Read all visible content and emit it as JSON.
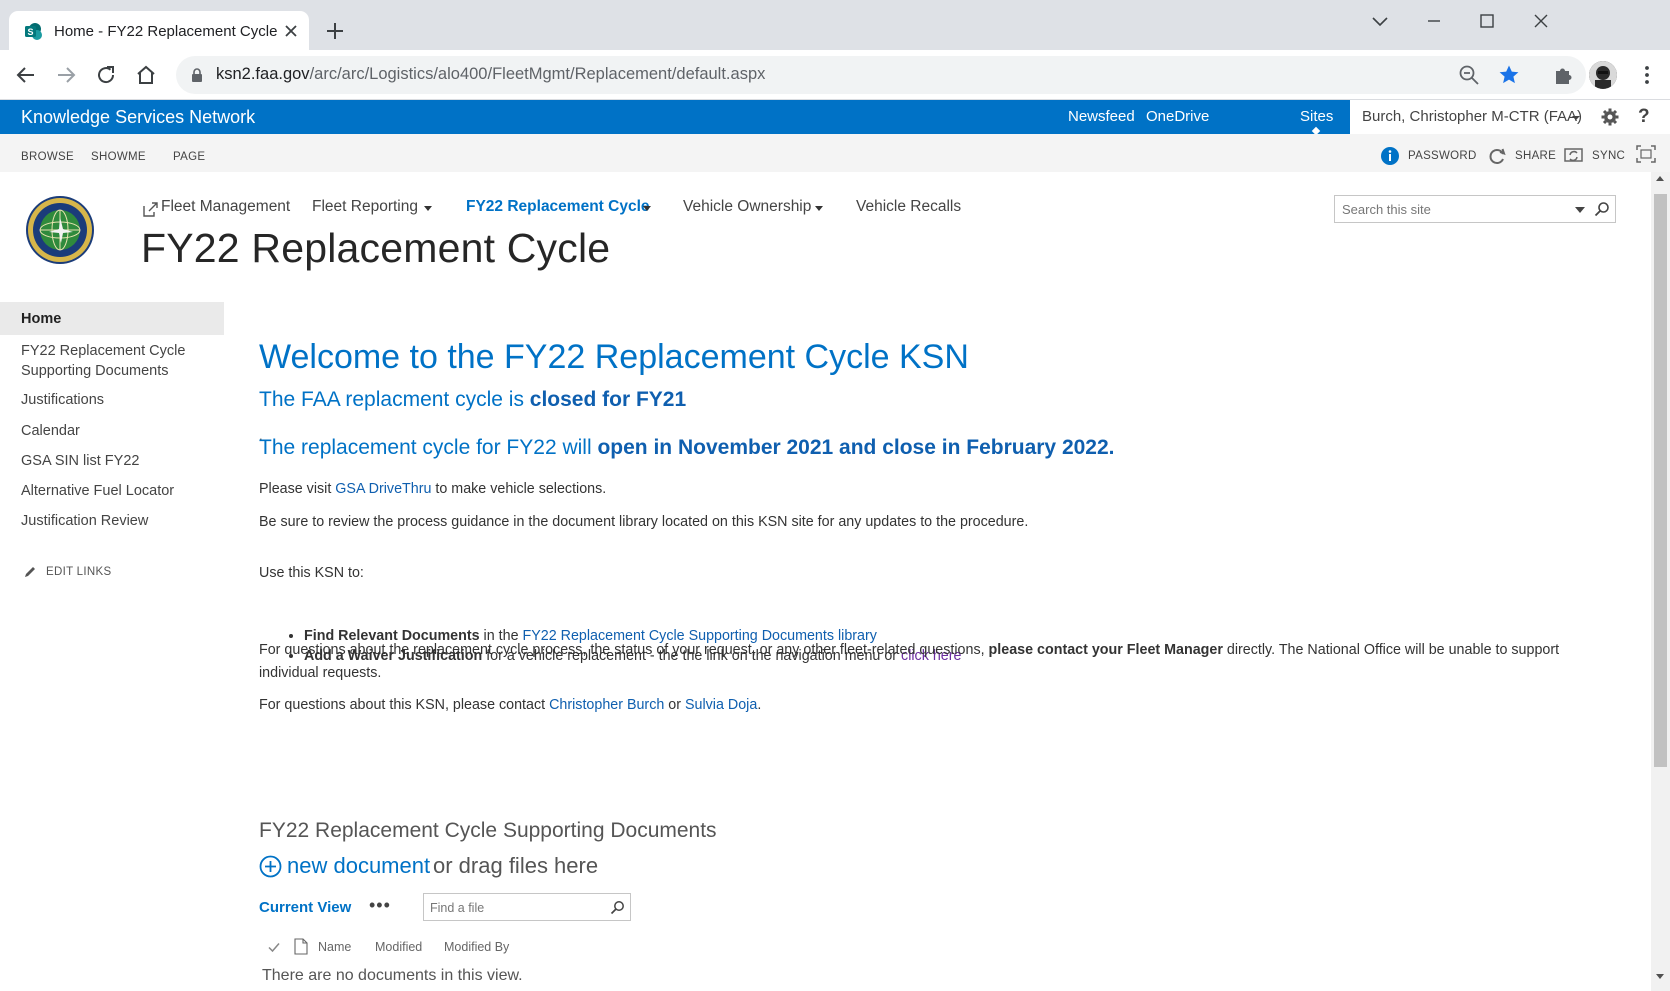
{
  "browser": {
    "tab_title": "Home - FY22 Replacement Cycle",
    "url_domain": "ksn2.faa.gov",
    "url_path": "/arc/arc/Logistics/alo400/FleetMgmt/Replacement/default.aspx"
  },
  "suite_bar": {
    "brand": "Knowledge Services Network",
    "links": [
      "Newsfeed",
      "OneDrive",
      "Sites"
    ],
    "user": "Burch, Christopher M-CTR (FAA)",
    "help": "?"
  },
  "ribbon": {
    "tabs": [
      "BROWSE",
      "SHOWME",
      "PAGE"
    ],
    "actions": [
      "PASSWORD",
      "SHARE",
      "SYNC"
    ]
  },
  "header": {
    "top_nav": [
      {
        "label": "Fleet Management"
      },
      {
        "label": "Fleet Reporting"
      },
      {
        "label": "FY22 Replacement Cycle"
      },
      {
        "label": "Vehicle Ownership"
      },
      {
        "label": "Vehicle Recalls"
      }
    ],
    "page_title": "FY22 Replacement Cycle",
    "search_placeholder": "Search this site"
  },
  "left_nav": {
    "items": [
      "Home",
      "FY22 Replacement Cycle",
      "Supporting Documents",
      "Justifications",
      "Calendar",
      "GSA SIN list FY22",
      "Alternative Fuel Locator",
      "Justification Review"
    ],
    "edit_links": "EDIT LINKS"
  },
  "content": {
    "welcome": "Welcome to the FY22 Replacement Cycle KSN",
    "closed_prefix": "The FAA replacment cycle is ",
    "closed_bold": "closed for FY21",
    "dot": ".",
    "open_prefix": "The replacement cycle for FY22 will ",
    "open_bold": "open in November 2021 and close in February 2022.",
    "visit_prefix": "Please visit ",
    "visit_link": "GSA DriveThru",
    "visit_suffix": " to make vehicle selections.",
    "review_text": "Be sure to review the process guidance in the document library located on this KSN site for any updates to the procedure.",
    "use_intro": "Use this KSN to:",
    "bullet1_bold": "Find Relevant Documents",
    "bullet1_mid": " in the ",
    "bullet1_link": "FY22 Replacement Cycle Supporting Documents library",
    "bullet2_bold": "Add a Waiver Justification",
    "bullet2_mid": " for a vehicle replacement - the the link on the navigation menu or ",
    "bullet2_link": "click here",
    "questions_prefix": "For questions about the replacement cycle process, the status of your request, or any other fleet-related questions, ",
    "questions_bold": "please contact your Fleet Manager",
    "questions_suffix": " directly. The National Office will be unable to support individual requests.",
    "contact_prefix": "For questions about this KSN, please contact ",
    "contact_link1": "Christopher Burch",
    "contact_or": " or ",
    "contact_link2": "Sulvia Doja",
    "contact_end": "."
  },
  "library": {
    "title": "FY22 Replacement Cycle Supporting Documents",
    "new_document": "new document",
    "drag_text": "or drag files here",
    "current_view": "Current View",
    "ellipsis": "•••",
    "find_placeholder": "Find a file",
    "columns": [
      "Name",
      "Modified",
      "Modified By"
    ],
    "empty_message": "There are no documents in this view."
  },
  "colors": {
    "suite_bar": "#0072c6",
    "link": "#0f5faf",
    "visited_link": "#6b2da0"
  }
}
